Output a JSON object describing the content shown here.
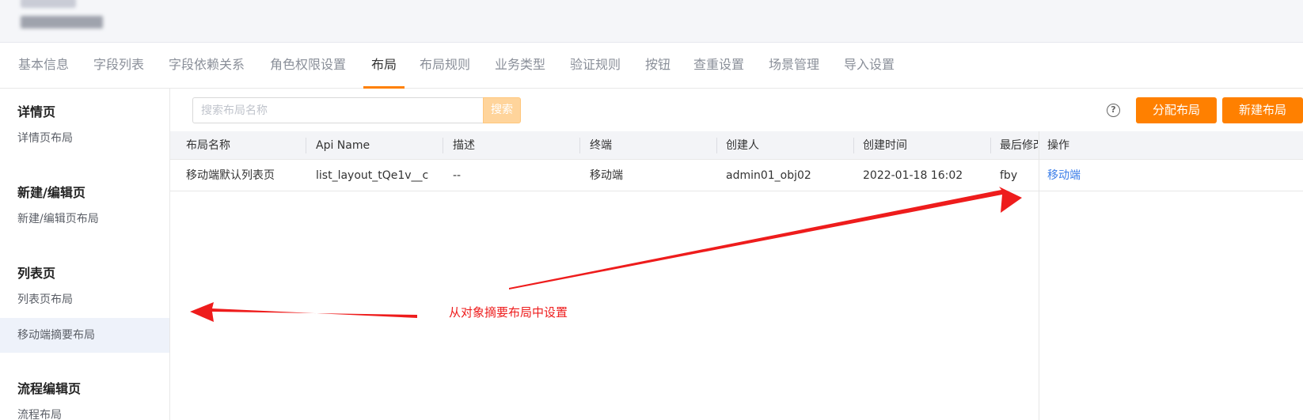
{
  "tabs": [
    {
      "label": "基本信息"
    },
    {
      "label": "字段列表"
    },
    {
      "label": "字段依赖关系"
    },
    {
      "label": "角色权限设置"
    },
    {
      "label": "布局",
      "active": true
    },
    {
      "label": "布局规则"
    },
    {
      "label": "业务类型"
    },
    {
      "label": "验证规则"
    },
    {
      "label": "按钮"
    },
    {
      "label": "查重设置"
    },
    {
      "label": "场景管理"
    },
    {
      "label": "导入设置"
    }
  ],
  "sidebar": {
    "detail_section": "详情页",
    "detail_layout": "详情页布局",
    "edit_section": "新建/编辑页",
    "edit_layout": "新建/编辑页布局",
    "list_section": "列表页",
    "list_layout": "列表页布局",
    "mobile_summary_layout": "移动端摘要布局",
    "flow_section": "流程编辑页",
    "flow_layout": "流程布局"
  },
  "toolbar": {
    "search_placeholder": "搜索布局名称",
    "search_button": "搜索",
    "assign_layout_button": "分配布局",
    "new_layout_button": "新建布局"
  },
  "table": {
    "columns": [
      "布局名称",
      "Api Name",
      "描述",
      "终端",
      "创建人",
      "创建时间",
      "最后修改",
      "操作"
    ],
    "rows": [
      {
        "name": "移动端默认列表页",
        "api_name": "list_layout_tQe1v__c",
        "description": "--",
        "terminal": "移动端",
        "creator": "admin01_obj02",
        "created_time": "2022-01-18 16:02",
        "last_modified": "fby",
        "action": "移动端"
      }
    ]
  },
  "annotation": {
    "text": "从对象摘要布局中设置",
    "color": "#ee1c1c"
  },
  "colors": {
    "accent": "#ff8000",
    "link": "#3a7de8"
  }
}
